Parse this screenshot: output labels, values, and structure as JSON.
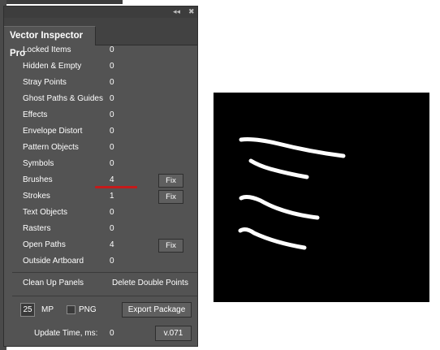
{
  "panel": {
    "tab_title": "Vector Inspector Pro",
    "collapse_glyph": "◂◂",
    "close_glyph": "✖",
    "rows": [
      {
        "label": "Locked Items",
        "value": "0"
      },
      {
        "label": "Hidden & Empty",
        "value": "0"
      },
      {
        "label": "Stray Points",
        "value": "0"
      },
      {
        "label": "Ghost Paths & Guides",
        "value": "0"
      },
      {
        "label": "Effects",
        "value": "0"
      },
      {
        "label": "Envelope Distort",
        "value": "0"
      },
      {
        "label": "Pattern Objects",
        "value": "0"
      },
      {
        "label": "Symbols",
        "value": "0"
      },
      {
        "label": "Brushes",
        "value": "4",
        "fix": "Fix"
      },
      {
        "label": "Strokes",
        "value": "1",
        "fix": "Fix"
      },
      {
        "label": "Text Objects",
        "value": "0"
      },
      {
        "label": "Rasters",
        "value": "0"
      },
      {
        "label": "Open Paths",
        "value": "4",
        "fix": "Fix"
      },
      {
        "label": "Outside Artboard",
        "value": "0"
      }
    ],
    "clean_up_panels": "Clean Up Panels",
    "delete_double_points": "Delete Double Points",
    "mp_value": "25",
    "mp_label": "MP",
    "png_label": "PNG",
    "export_package": "Export Package",
    "update_time_label": "Update Time, ms:",
    "update_time_value": "0",
    "version": "v.071"
  },
  "colors": {
    "panel_bg": "#535353",
    "highlight_underline": "#c41a1a",
    "canvas_bg": "#000000",
    "stroke": "#ffffff"
  },
  "icons": [
    "collapse-arrows-icon",
    "close-icon"
  ]
}
